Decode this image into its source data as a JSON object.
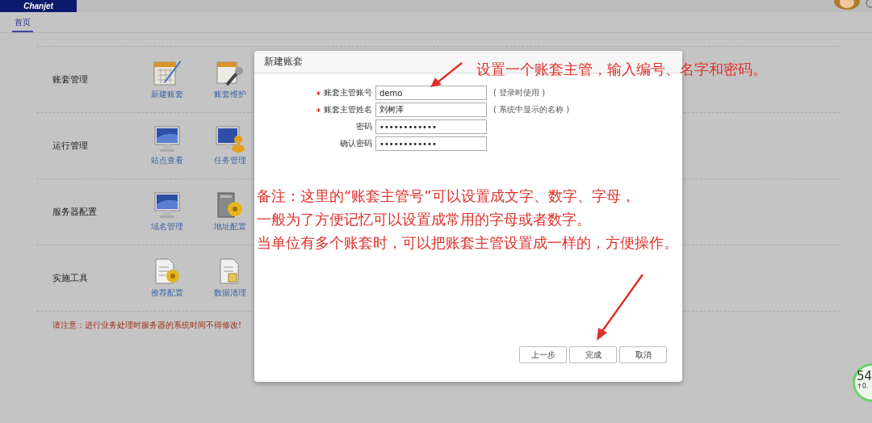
{
  "header": {
    "logo": "Chanjet"
  },
  "tabs": [
    {
      "label": "首页",
      "selected": true
    }
  ],
  "sections": [
    {
      "title": "账套管理",
      "items": [
        {
          "label": "新建账套",
          "kind": "calendar"
        },
        {
          "label": "账套维护",
          "kind": "tool"
        }
      ]
    },
    {
      "title": "运行管理",
      "items": [
        {
          "label": "站点查看",
          "kind": "monitor"
        },
        {
          "label": "任务管理",
          "kind": "monitor-user"
        }
      ]
    },
    {
      "title": "服务器配置",
      "items": [
        {
          "label": "域名管理",
          "kind": "monitor"
        },
        {
          "label": "地址配置",
          "kind": "server-gear"
        }
      ]
    },
    {
      "title": "实施工具",
      "items": [
        {
          "label": "推荐配置",
          "kind": "doc-gear"
        },
        {
          "label": "数据清理",
          "kind": "doc-box"
        }
      ]
    }
  ],
  "notice": "请注意：进行业务处理时服务器的系统时间不得修改!",
  "dialog": {
    "title": "新建账套",
    "fields": [
      {
        "label": "账套主管账号",
        "required": true,
        "value": "demo",
        "hint": "( 登录时使用 )"
      },
      {
        "label": "账套主管姓名",
        "required": true,
        "value": "刘树泽",
        "hint": "( 系统中显示的名称 )"
      },
      {
        "label": "密码",
        "required": false,
        "value": "••••••••••••"
      },
      {
        "label": "确认密码",
        "required": false,
        "value": "••••••••••••"
      }
    ],
    "buttons": [
      "上一步",
      "完成",
      "取消"
    ]
  },
  "annotations": {
    "heading": "设置一个账套主管，输入编号、名字和密码。",
    "note_lines": [
      "备注：这里的“账套主管号”可以设置成文字、数字、字母，",
      "一般为了方便记忆可以设置成常用的字母或者数字。",
      "当单位有多个账套时，可以把账套主管设置成一样的，方便操作。"
    ]
  },
  "widget": {
    "reading": "54",
    "rate": "↑0."
  }
}
